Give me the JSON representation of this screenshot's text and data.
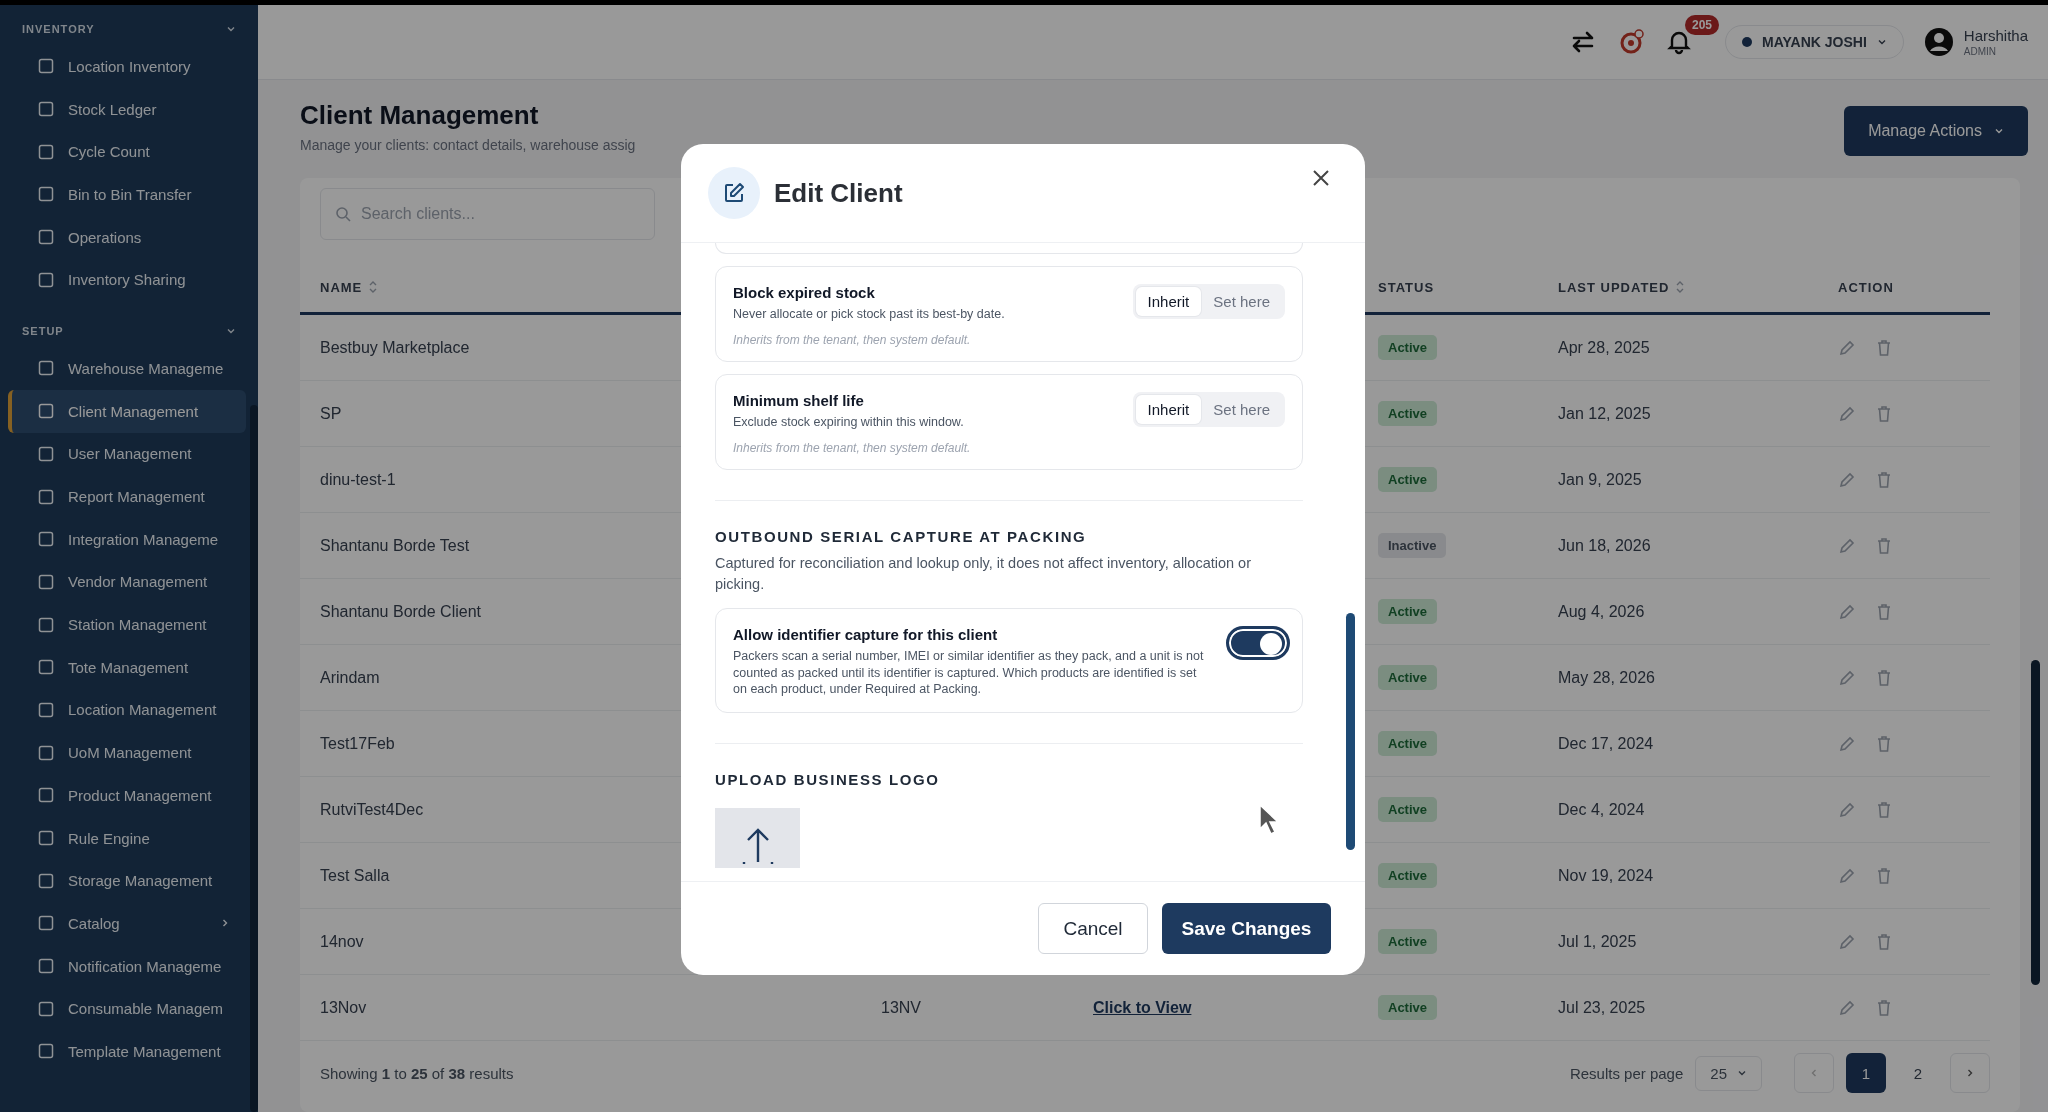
{
  "sidebar": {
    "sections": [
      {
        "title": "INVENTORY",
        "expanded": true,
        "items": [
          {
            "label": "Location Inventory",
            "selected": false
          },
          {
            "label": "Stock Ledger",
            "selected": false
          },
          {
            "label": "Cycle Count",
            "selected": false
          },
          {
            "label": "Bin to Bin Transfer",
            "selected": false
          },
          {
            "label": "Operations",
            "selected": false
          },
          {
            "label": "Inventory Sharing",
            "selected": false
          }
        ]
      },
      {
        "title": "SETUP",
        "expanded": true,
        "items": [
          {
            "label": "Warehouse Manageme",
            "selected": false
          },
          {
            "label": "Client Management",
            "selected": true
          },
          {
            "label": "User Management",
            "selected": false
          },
          {
            "label": "Report Management",
            "selected": false
          },
          {
            "label": "Integration Manageme",
            "selected": false
          },
          {
            "label": "Vendor Management",
            "selected": false
          },
          {
            "label": "Station Management",
            "selected": false
          },
          {
            "label": "Tote Management",
            "selected": false
          },
          {
            "label": "Location Management",
            "selected": false
          },
          {
            "label": "UoM Management",
            "selected": false
          },
          {
            "label": "Product Management",
            "selected": false
          },
          {
            "label": "Rule Engine",
            "selected": false
          },
          {
            "label": "Storage Management",
            "selected": false
          },
          {
            "label": "Catalog",
            "selected": false,
            "has_submenu": true
          },
          {
            "label": "Notification Manageme",
            "selected": false
          },
          {
            "label": "Consumable Managem",
            "selected": false
          },
          {
            "label": "Template Management",
            "selected": false
          }
        ]
      }
    ]
  },
  "header": {
    "notification_count": "205",
    "location": "MAYANK JOSHI",
    "user_name": "Harshitha",
    "user_role": "ADMIN"
  },
  "page": {
    "title": "Client Management",
    "subtitle": "Manage your clients: contact details, warehouse assig",
    "actions_button": "Manage Actions"
  },
  "search": {
    "placeholder": "Search clients..."
  },
  "table": {
    "columns": [
      {
        "label": "NAME",
        "sortable": true
      },
      {
        "label": "STATUS",
        "sortable": false
      },
      {
        "label": "LAST UPDATED",
        "sortable": true
      },
      {
        "label": "ACTION",
        "sortable": false
      }
    ],
    "rows": [
      {
        "name": "Bestbuy Marketplace",
        "status": {
          "label": "Active",
          "active": true
        },
        "updated": "Apr 28, 2025"
      },
      {
        "name": "SP",
        "status": {
          "label": "Active",
          "active": true
        },
        "updated": "Jan 12, 2025"
      },
      {
        "name": "dinu-test-1",
        "status": {
          "label": "Active",
          "active": true
        },
        "updated": "Jan 9, 2025"
      },
      {
        "name": "Shantanu Borde Test",
        "status": {
          "label": "Inactive",
          "active": false
        },
        "updated": "Jun 18, 2026"
      },
      {
        "name": "Shantanu Borde Client",
        "status": {
          "label": "Active",
          "active": true
        },
        "updated": "Aug 4, 2026"
      },
      {
        "name": "Arindam",
        "status": {
          "label": "Active",
          "active": true
        },
        "updated": "May 28, 2026"
      },
      {
        "name": "Test17Feb",
        "status": {
          "label": "Active",
          "active": true
        },
        "updated": "Dec 17, 2024"
      },
      {
        "name": "RutviTest4Dec",
        "status": {
          "label": "Active",
          "active": true
        },
        "updated": "Dec 4, 2024"
      },
      {
        "name": "Test Salla",
        "status": {
          "label": "Active",
          "active": true
        },
        "updated": "Nov 19, 2024"
      },
      {
        "name": "14nov",
        "status": {
          "label": "Active",
          "active": true
        },
        "updated": "Jul 1, 2025"
      },
      {
        "name": "13Nov",
        "code": "13NV",
        "link": "Click to View",
        "status": {
          "label": "Active",
          "active": true
        },
        "updated": "Jul 23, 2025"
      }
    ]
  },
  "pagination": {
    "summary": "Showing **1** to **25** of **38** results",
    "per_page_label": "Results per page",
    "per_page": "25",
    "pages": [
      {
        "label": "1",
        "selected": true
      },
      {
        "label": "2",
        "selected": false
      }
    ]
  },
  "modal": {
    "title": "Edit Client",
    "settings": [
      {
        "title": "Block expired stock",
        "description": "Never allocate or pick stock past its best-by date.",
        "note": "Inherits from the tenant, then system default.",
        "options": [
          {
            "label": "Inherit",
            "selected": true
          },
          {
            "label": "Set here",
            "selected": false
          }
        ]
      },
      {
        "title": "Minimum shelf life",
        "description": "Exclude stock expiring within this window.",
        "note": "Inherits from the tenant, then system default.",
        "options": [
          {
            "label": "Inherit",
            "selected": true
          },
          {
            "label": "Set here",
            "selected": false
          }
        ]
      }
    ],
    "serial_section": {
      "title": "OUTBOUND SERIAL CAPTURE AT PACKING",
      "description": "Captured for reconciliation and lookup only, it does not affect inventory, allocation or picking.",
      "toggle": {
        "title": "Allow identifier capture for this client",
        "description": "Packers scan a serial number, IMEI or similar identifier as they pack, and a unit is not counted as packed until its identifier is captured. Which products are identified is set on each product, under Required at Packing.",
        "on": true
      }
    },
    "logo_section": {
      "title": "UPLOAD BUSINESS LOGO"
    },
    "buttons": [
      {
        "label": "Cancel",
        "kind": "secondary"
      },
      {
        "label": "Save Changes",
        "kind": "primary"
      }
    ]
  }
}
